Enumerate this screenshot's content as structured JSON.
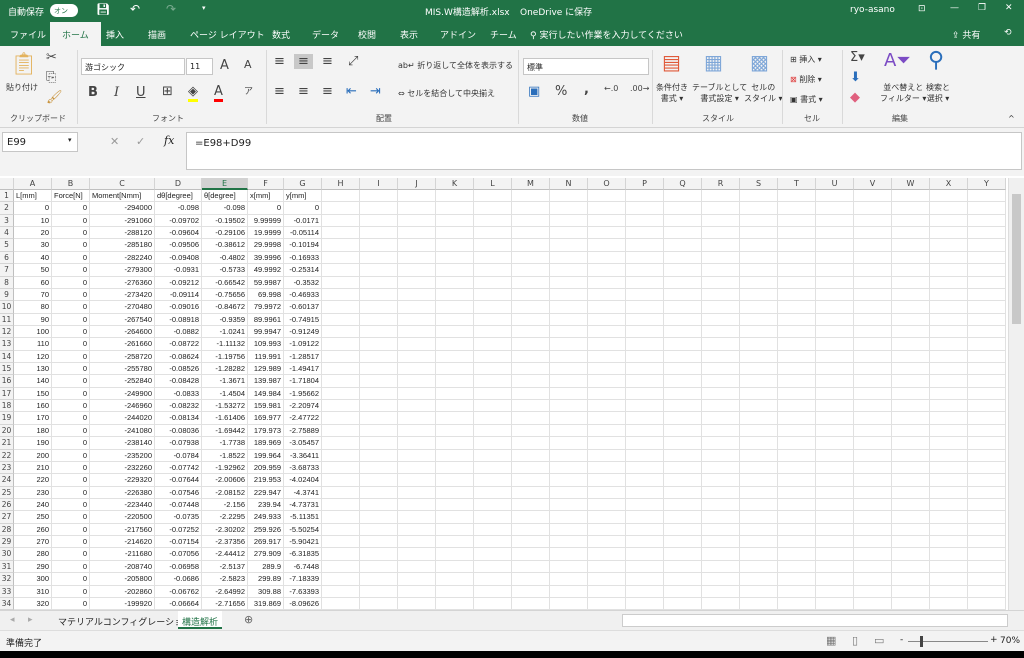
{
  "title": {
    "autosave_label": "自動保存",
    "autosave_state": "オン",
    "filename": "MIS.W構造解析.xlsx",
    "save_location": "OneDrive に保存",
    "user": "ryo-asano"
  },
  "tabs": [
    "ファイル",
    "ホーム",
    "挿入",
    "描画",
    "ページ レイアウト",
    "数式",
    "データ",
    "校閲",
    "表示",
    "アドイン",
    "チーム"
  ],
  "active_tab": "ホーム",
  "tell_me": "実行したい作業を入力してください",
  "share": "共有",
  "ribbon": {
    "clipboard": {
      "label": "クリップボード",
      "paste": "貼り付け"
    },
    "font": {
      "label": "フォント",
      "name": "游ゴシック",
      "size": "11",
      "bold": "B",
      "italic": "I",
      "underline": "U"
    },
    "alignment": {
      "label": "配置",
      "wrap": "折り返して全体を表示する",
      "merge": "セルを結合して中央揃え"
    },
    "number": {
      "label": "数値",
      "format": "標準",
      "percent": "%",
      "comma": ","
    },
    "styles": {
      "label": "スタイル",
      "conditional": [
        "条件付き",
        "書式"
      ],
      "table": [
        "テーブルとして",
        "書式設定"
      ],
      "cell": [
        "セルの",
        "スタイル"
      ]
    },
    "cells": {
      "label": "セル",
      "insert": "挿入",
      "delete": "削除",
      "format": "書式"
    },
    "editing": {
      "label": "編集",
      "sort": [
        "並べ替えと",
        "フィルター"
      ],
      "find": [
        "検索と",
        "選択"
      ]
    }
  },
  "formula_bar": {
    "name_box": "E99",
    "fx": "fx",
    "formula": "=E98+D99"
  },
  "columns": [
    "A",
    "B",
    "C",
    "D",
    "E",
    "F",
    "G",
    "H",
    "I",
    "J",
    "K",
    "L",
    "M",
    "N",
    "O",
    "P",
    "Q",
    "R",
    "S",
    "T",
    "U",
    "V",
    "W",
    "X",
    "Y"
  ],
  "selected_column": "E",
  "headers": [
    "L[mm]",
    "Force[N]",
    "Moment[Nmm]",
    "dθ[degree]",
    "θ[degree]",
    "x[mm]",
    "y[mm]"
  ],
  "rows": [
    [
      "0",
      "0",
      "-294000",
      "-0.098",
      "-0.098",
      "0",
      "0"
    ],
    [
      "10",
      "0",
      "-291060",
      "-0.09702",
      "-0.19502",
      "9.99999",
      "-0.0171"
    ],
    [
      "20",
      "0",
      "-288120",
      "-0.09604",
      "-0.29106",
      "19.9999",
      "-0.05114"
    ],
    [
      "30",
      "0",
      "-285180",
      "-0.09506",
      "-0.38612",
      "29.9998",
      "-0.10194"
    ],
    [
      "40",
      "0",
      "-282240",
      "-0.09408",
      "-0.4802",
      "39.9996",
      "-0.16933"
    ],
    [
      "50",
      "0",
      "-279300",
      "-0.0931",
      "-0.5733",
      "49.9992",
      "-0.25314"
    ],
    [
      "60",
      "0",
      "-276360",
      "-0.09212",
      "-0.66542",
      "59.9987",
      "-0.3532"
    ],
    [
      "70",
      "0",
      "-273420",
      "-0.09114",
      "-0.75656",
      "69.998",
      "-0.46933"
    ],
    [
      "80",
      "0",
      "-270480",
      "-0.09016",
      "-0.84672",
      "79.9972",
      "-0.60137"
    ],
    [
      "90",
      "0",
      "-267540",
      "-0.08918",
      "-0.9359",
      "89.9961",
      "-0.74915"
    ],
    [
      "100",
      "0",
      "-264600",
      "-0.0882",
      "-1.0241",
      "99.9947",
      "-0.91249"
    ],
    [
      "110",
      "0",
      "-261660",
      "-0.08722",
      "-1.11132",
      "109.993",
      "-1.09122"
    ],
    [
      "120",
      "0",
      "-258720",
      "-0.08624",
      "-1.19756",
      "119.991",
      "-1.28517"
    ],
    [
      "130",
      "0",
      "-255780",
      "-0.08526",
      "-1.28282",
      "129.989",
      "-1.49417"
    ],
    [
      "140",
      "0",
      "-252840",
      "-0.08428",
      "-1.3671",
      "139.987",
      "-1.71804"
    ],
    [
      "150",
      "0",
      "-249900",
      "-0.0833",
      "-1.4504",
      "149.984",
      "-1.95662"
    ],
    [
      "160",
      "0",
      "-246960",
      "-0.08232",
      "-1.53272",
      "159.981",
      "-2.20974"
    ],
    [
      "170",
      "0",
      "-244020",
      "-0.08134",
      "-1.61406",
      "169.977",
      "-2.47722"
    ],
    [
      "180",
      "0",
      "-241080",
      "-0.08036",
      "-1.69442",
      "179.973",
      "-2.75889"
    ],
    [
      "190",
      "0",
      "-238140",
      "-0.07938",
      "-1.7738",
      "189.969",
      "-3.05457"
    ],
    [
      "200",
      "0",
      "-235200",
      "-0.0784",
      "-1.8522",
      "199.964",
      "-3.36411"
    ],
    [
      "210",
      "0",
      "-232260",
      "-0.07742",
      "-1.92962",
      "209.959",
      "-3.68733"
    ],
    [
      "220",
      "0",
      "-229320",
      "-0.07644",
      "-2.00606",
      "219.953",
      "-4.02404"
    ],
    [
      "230",
      "0",
      "-226380",
      "-0.07546",
      "-2.08152",
      "229.947",
      "-4.3741"
    ],
    [
      "240",
      "0",
      "-223440",
      "-0.07448",
      "-2.156",
      "239.94",
      "-4.73731"
    ],
    [
      "250",
      "0",
      "-220500",
      "-0.0735",
      "-2.2295",
      "249.933",
      "-5.11351"
    ],
    [
      "260",
      "0",
      "-217560",
      "-0.07252",
      "-2.30202",
      "259.926",
      "-5.50254"
    ],
    [
      "270",
      "0",
      "-214620",
      "-0.07154",
      "-2.37356",
      "269.917",
      "-5.90421"
    ],
    [
      "280",
      "0",
      "-211680",
      "-0.07056",
      "-2.44412",
      "279.909",
      "-6.31835"
    ],
    [
      "290",
      "0",
      "-208740",
      "-0.06958",
      "-2.5137",
      "289.9",
      "-6.7448"
    ],
    [
      "300",
      "0",
      "-205800",
      "-0.0686",
      "-2.5823",
      "299.89",
      "-7.18339"
    ],
    [
      "310",
      "0",
      "-202860",
      "-0.06762",
      "-2.64992",
      "309.88",
      "-7.63393"
    ],
    [
      "320",
      "0",
      "-199920",
      "-0.06664",
      "-2.71656",
      "319.869",
      "-8.09626"
    ]
  ],
  "sheets": [
    "マテリアルコンフィグレーション",
    "構造解析"
  ],
  "active_sheet": "構造解析",
  "status": {
    "ready": "準備完了",
    "zoom": "70%",
    "zoom_percent": 70
  },
  "colors": {
    "brand": "#217346",
    "ribbon": "#f3f3f3"
  }
}
